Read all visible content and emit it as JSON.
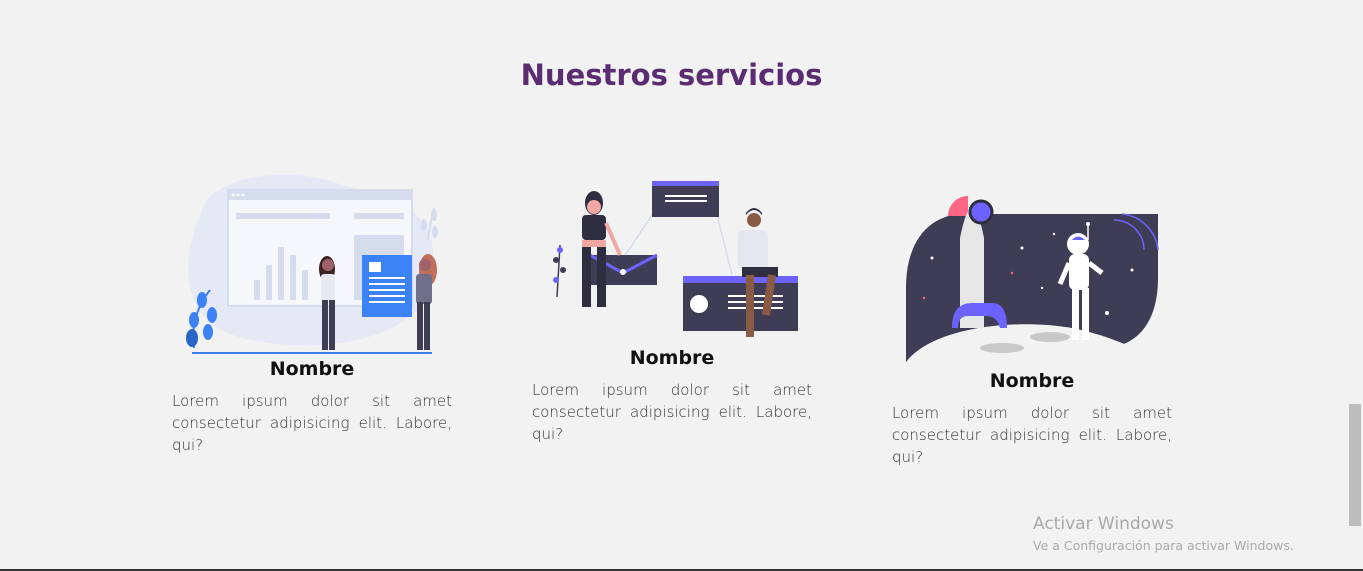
{
  "section": {
    "title": "Nuestros servicios"
  },
  "services": [
    {
      "title": "Nombre",
      "text": "Lorem ipsum dolor sit amet consectetur adipisicing elit. Labore, qui?",
      "illustration": "team-dashboard-illustration"
    },
    {
      "title": "Nombre",
      "text": "Lorem ipsum dolor sit amet consectetur adipisicing elit. Labore, qui?",
      "illustration": "mail-collaboration-illustration"
    },
    {
      "title": "Nombre",
      "text": "Lorem ipsum dolor sit amet consectetur adipisicing elit. Labore, qui?",
      "illustration": "astronaut-rocket-illustration"
    }
  ],
  "watermark": {
    "line1": "Activar Windows",
    "line2": "Ve a Configuración para activar Windows."
  },
  "colors": {
    "title": "#5c2c73",
    "accent_purple": "#6c63ff",
    "dark_panel": "#3f3d56",
    "blue": "#3b82f6"
  }
}
